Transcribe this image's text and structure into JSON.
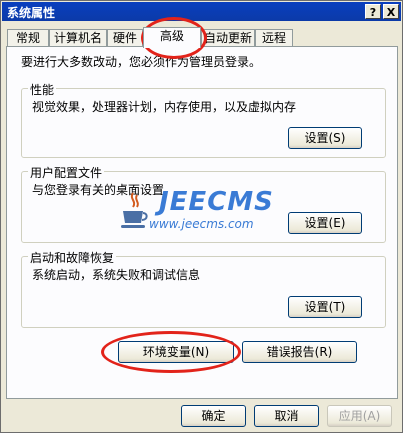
{
  "window": {
    "title": "系统属性",
    "help_btn": "?",
    "close_btn": "X"
  },
  "tabs": [
    "常规",
    "计算机名",
    "硬件",
    "高级",
    "自动更新",
    "远程"
  ],
  "notice": "要进行大多数改动，您必须作为管理员登录。",
  "groups": {
    "performance": {
      "title": "性能",
      "desc": "视觉效果，处理器计划，内存使用，以及虚拟内存",
      "button": "设置(S)"
    },
    "profiles": {
      "title": "用户配置文件",
      "desc": "与您登录有关的桌面设置",
      "button": "设置(E)"
    },
    "startup": {
      "title": "启动和故障恢复",
      "desc": "系统启动，系统失败和调试信息",
      "button": "设置(T)"
    }
  },
  "buttons": {
    "env_vars": "环境变量(N)",
    "error_report": "错误报告(R)",
    "ok": "确定",
    "cancel": "取消",
    "apply": "应用(A)"
  },
  "watermark": {
    "brand": "JEECMS",
    "url": "www.jeecms.com"
  },
  "colors": {
    "highlight_ring": "#e2231a",
    "titlebar": "#0a3fbf",
    "watermark": "#3a7bd5"
  }
}
